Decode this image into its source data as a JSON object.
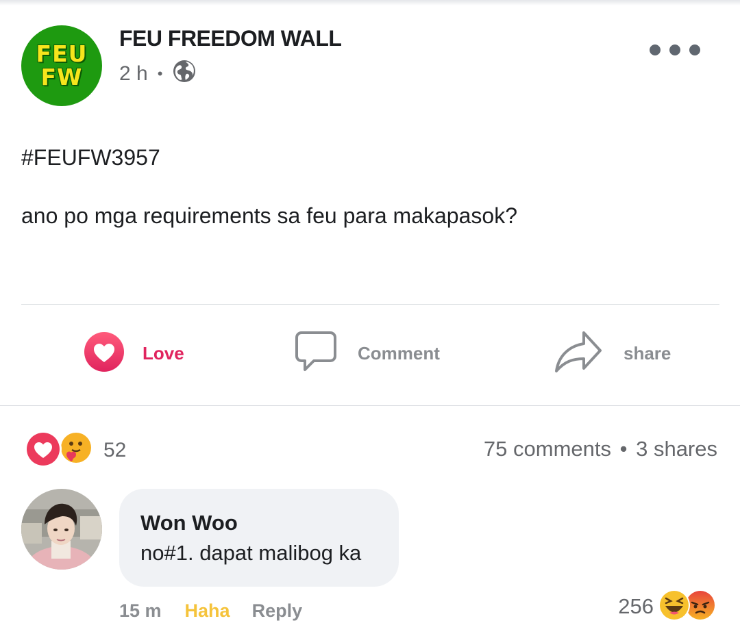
{
  "post": {
    "page_name": "FEU FREEDOM WALL",
    "avatar_text": [
      "FEU",
      "FW"
    ],
    "time": "2 h",
    "separator": "•",
    "audience_icon": "globe-icon",
    "hashtag": "#FEUFW3957",
    "body": "ano po mga requirements sa feu para makapasok?"
  },
  "actions": {
    "love": "Love",
    "comment": "Comment",
    "share": "share"
  },
  "summary": {
    "reaction_icons": [
      "love-icon",
      "care-icon"
    ],
    "reaction_count": "52",
    "comments": "75 comments",
    "separator": "•",
    "shares": "3 shares"
  },
  "comment": {
    "author": "Won Woo",
    "text": "no#1. dapat malibog ka",
    "time": "15 m",
    "reaction_label": "Haha",
    "reply_label": "Reply",
    "reaction_count": "256",
    "reaction_icons": [
      "haha-icon",
      "angry-icon"
    ]
  },
  "colors": {
    "love_red": "#e0245e",
    "haha_yellow": "#f5c33b",
    "page_green": "#1e9a10",
    "muted_text": "#65676b"
  }
}
